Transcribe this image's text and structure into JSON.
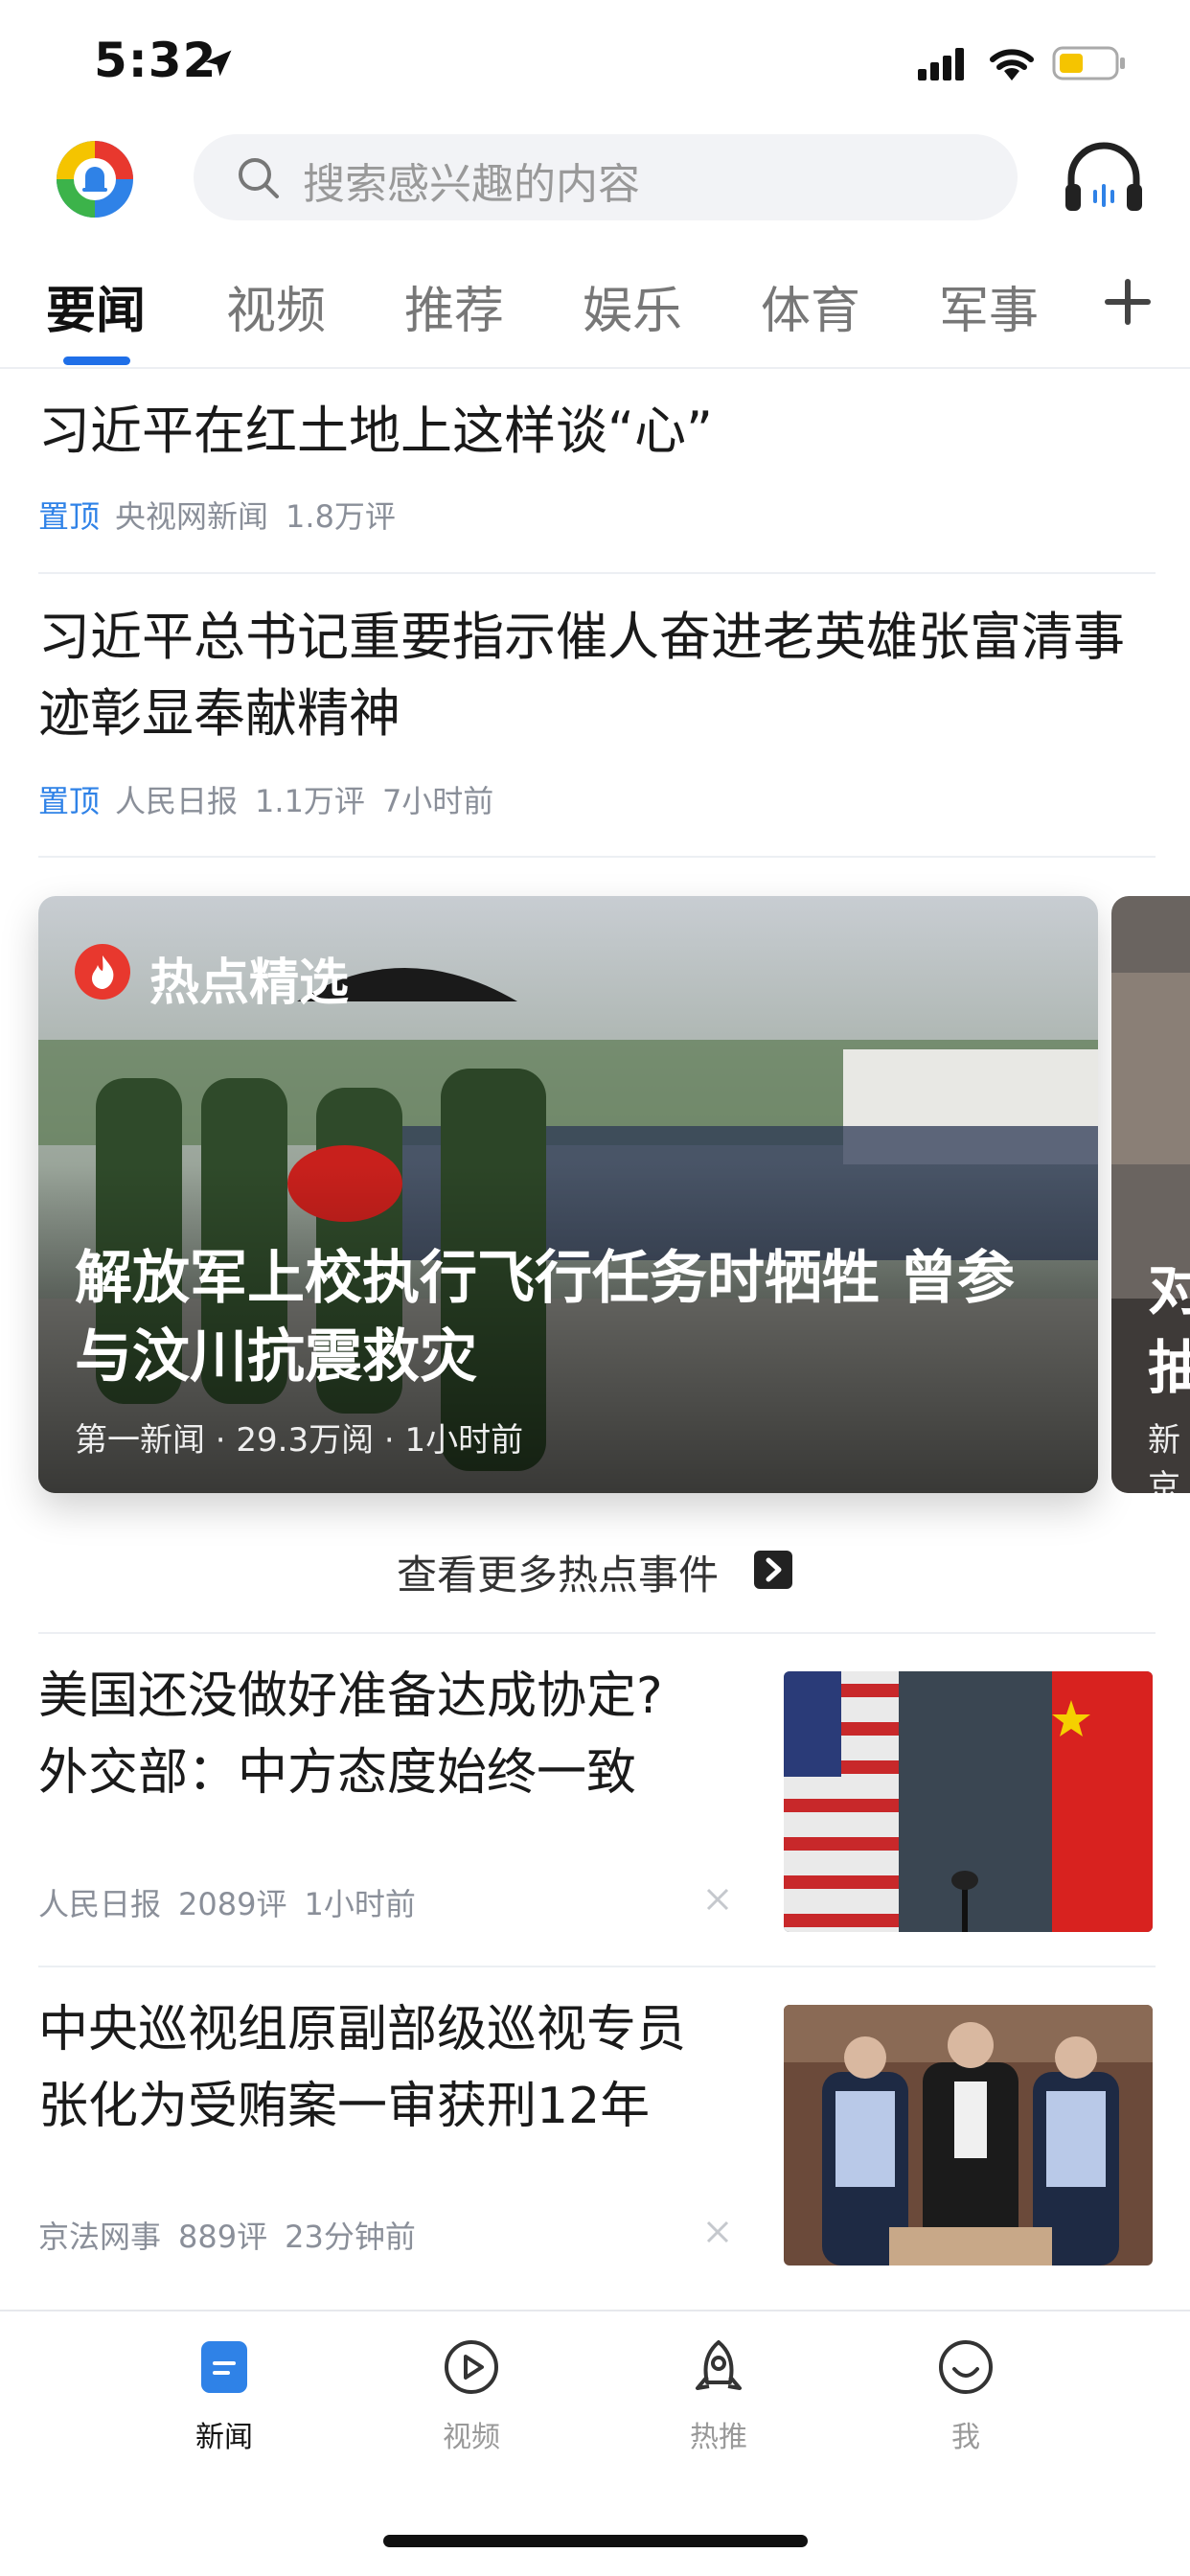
{
  "status_bar": {
    "time": "5:32"
  },
  "header": {
    "search_placeholder": "搜索感兴趣的内容"
  },
  "tabs": [
    "要闻",
    "视频",
    "推荐",
    "娱乐",
    "体育",
    "军事"
  ],
  "top_articles": [
    {
      "title": "习近平在红土地上这样谈“心”",
      "pin": "置顶",
      "source": "央视网新闻",
      "comments": "1.8万评",
      "time": ""
    },
    {
      "title": "习近平总书记重要指示催人奋进老英雄张富清事迹彰显奉献精神",
      "pin": "置顶",
      "source": "人民日报",
      "comments": "1.1万评",
      "time": "7小时前"
    }
  ],
  "hot": {
    "badge": "热点精选",
    "title": "解放军上校执行飞行任务时牺牲 曾参与汶川抗震救灾",
    "meta": "第一新闻 · 29.3万阅 · 1小时前",
    "next_title": "对\n抽",
    "next_meta": "新京",
    "more": "查看更多热点事件"
  },
  "articles": [
    {
      "title": "美国还没做好准备达成协定?外交部：中方态度始终一致",
      "source": "人民日报",
      "comments": "2089评",
      "time": "1小时前"
    },
    {
      "title": "中央巡视组原副部级巡视专员张化为受贿案一审获刑12年",
      "source": "京法网事",
      "comments": "889评",
      "time": "23分钟前"
    }
  ],
  "bottom_nav": [
    "新闻",
    "视频",
    "热推",
    "我"
  ],
  "colors": {
    "accent": "#1f6fe8",
    "pin": "#2f82e7",
    "hot": "#e8382e"
  }
}
